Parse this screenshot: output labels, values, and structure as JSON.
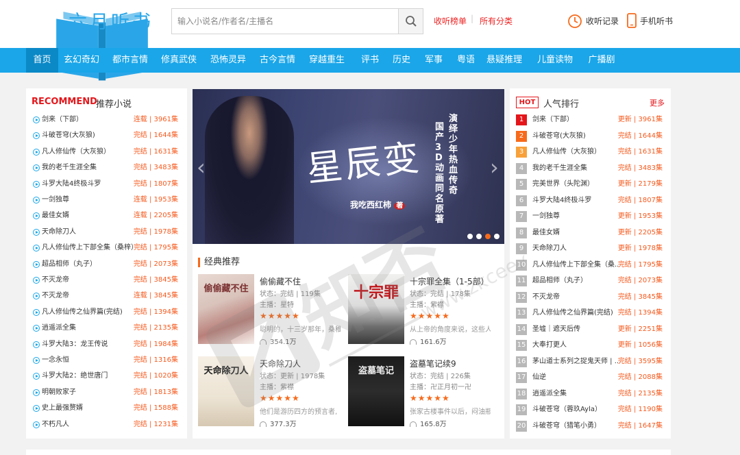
{
  "header": {
    "logo_text": "六月听书",
    "logo_sub": "6yueting",
    "search_placeholder": "输入小说名/作者名/主播名",
    "links": [
      "收听榜单",
      "所有分类"
    ],
    "history_label": "收听记录",
    "mobile_label": "手机听书"
  },
  "nav": [
    "首页",
    "玄幻奇幻",
    "都市言情",
    "修真武侠",
    "恐怖灵异",
    "古今言情",
    "穿越重生",
    "评书",
    "历史",
    "军事",
    "粤语",
    "悬疑推理",
    "儿童读物",
    "广播剧"
  ],
  "recommend": {
    "title_en": "RECOMMEND",
    "title_cn": "推荐小说",
    "items": [
      {
        "name": "剑来（下部）",
        "status": "连载 | 3961集"
      },
      {
        "name": "斗破苍穹(大灰狼)",
        "status": "完结 | 1644集"
      },
      {
        "name": "凡人修仙传（大灰狼）",
        "status": "完结 | 1631集"
      },
      {
        "name": "我的老千生涯全集",
        "status": "完结 | 3483集"
      },
      {
        "name": "斗罗大陆4终极斗罗",
        "status": "完结 | 1807集"
      },
      {
        "name": "一剑独尊",
        "status": "连载 | 1953集"
      },
      {
        "name": "最佳女婿",
        "status": "连载 | 2205集"
      },
      {
        "name": "天命除刀人",
        "status": "完结 | 1978集"
      },
      {
        "name": "凡人修仙传上下部全集（桑梓）",
        "status": "完结 | 1795集"
      },
      {
        "name": "超品相师（丸子）",
        "status": "完结 | 2073集"
      },
      {
        "name": "不灭龙帝",
        "status": "完结 | 3845集"
      },
      {
        "name": "不灭龙帝",
        "status": "连载 | 3845集"
      },
      {
        "name": "凡人修仙传之仙界篇(完结)",
        "status": "完结 | 1394集"
      },
      {
        "name": "逍遥派全集",
        "status": "完结 | 2135集"
      },
      {
        "name": "斗罗大陆3：龙王传说",
        "status": "完结 | 1984集"
      },
      {
        "name": "一念永恒",
        "status": "完结 | 1316集"
      },
      {
        "name": "斗罗大陆2：绝世唐门",
        "status": "完结 | 1020集"
      },
      {
        "name": "明朝败家子",
        "status": "完结 | 1813集"
      },
      {
        "name": "史上最强赘婿",
        "status": "完结 | 1588集"
      },
      {
        "name": "不朽凡人",
        "status": "完结 | 1231集"
      }
    ]
  },
  "banner": {
    "title": "星辰变",
    "vertical_lines": [
      "演绎少年热血传奇",
      "国产3D动画同名原著"
    ],
    "author": "我吃西红柿",
    "author_badge": "著",
    "dots": 4,
    "active_dot": 3,
    "prev": "‹",
    "next": "›"
  },
  "classic": {
    "title": "经典推荐",
    "books": [
      {
        "title": "偷偷藏不住",
        "status": "状态：完结 | 119集",
        "anchor": "主播：星特",
        "stars": "★★★★★",
        "desc": "聪明的，十三岁那年，桑稚",
        "plays": "354.1万",
        "cover_text": "偷偷藏不住"
      },
      {
        "title": "十宗罪全集（1-5部）",
        "status": "状态：完结 | 178集",
        "anchor": "主播：紫襟",
        "stars": "★★★★★",
        "desc": "从上帝的角度来说，这些人",
        "plays": "161.6万",
        "cover_text": "十宗罪"
      },
      {
        "title": "天命除刀人",
        "status": "状态：更新 | 1978集",
        "anchor": "主播：紫襟",
        "stars": "★★★★★",
        "desc": "他们是游历四方的预言者,",
        "plays": "377.3万",
        "cover_text": "天命除刀人"
      },
      {
        "title": "盗墓笔记续9",
        "status": "状态：完结 | 226集",
        "anchor": "主播：卍正月初一卍",
        "stars": "★★★★★",
        "desc": "张家古楼事件以后，闷油瓶",
        "plays": "165.8万",
        "cover_text": "盗墓笔记"
      }
    ]
  },
  "ranking": {
    "badge": "HOT",
    "title": "人气排行",
    "more": "更多",
    "items": [
      {
        "rank": "1",
        "name": "剑来（下部）",
        "status": "更新 | 3961集"
      },
      {
        "rank": "2",
        "name": "斗破苍穹(大灰狼)",
        "status": "完结 | 1644集"
      },
      {
        "rank": "3",
        "name": "凡人修仙传（大灰狼）",
        "status": "完结 | 1631集"
      },
      {
        "rank": "4",
        "name": "我的老千生涯全集",
        "status": "完结 | 3483集"
      },
      {
        "rank": "5",
        "name": "完美世界（头陀渊）",
        "status": "更新 | 2179集"
      },
      {
        "rank": "6",
        "name": "斗罗大陆4终极斗罗",
        "status": "完结 | 1807集"
      },
      {
        "rank": "7",
        "name": "一剑独尊",
        "status": "更新 | 1953集"
      },
      {
        "rank": "8",
        "name": "最佳女婿",
        "status": "更新 | 2205集"
      },
      {
        "rank": "9",
        "name": "天命除刀人",
        "status": "更新 | 1978集"
      },
      {
        "rank": "10",
        "name": "凡人修仙传上下部全集（桑...",
        "status": "完结 | 1795集"
      },
      {
        "rank": "11",
        "name": "超品相师（丸子）",
        "status": "完结 | 2073集"
      },
      {
        "rank": "12",
        "name": "不灭龙帝",
        "status": "完结 | 3845集"
      },
      {
        "rank": "13",
        "name": "凡人修仙传之仙界篇(完结)",
        "status": "完结 | 1394集"
      },
      {
        "rank": "14",
        "name": "圣墟｜遮天后传",
        "status": "更新 | 2251集"
      },
      {
        "rank": "15",
        "name": "大奉打更人",
        "status": "更新 | 1056集"
      },
      {
        "rank": "16",
        "name": "茅山道士系列之捉鬼天师 | ...",
        "status": "完结 | 3595集"
      },
      {
        "rank": "17",
        "name": "仙逆",
        "status": "完结 | 2088集"
      },
      {
        "rank": "18",
        "name": "逍遥派全集",
        "status": "完结 | 2135集"
      },
      {
        "rank": "19",
        "name": "斗破苍穹（蓉玖Ayla）",
        "status": "完结 | 1190集"
      },
      {
        "rank": "20",
        "name": "斗破苍穹（猎笔小勇）",
        "status": "完结 | 1647集"
      }
    ]
  },
  "watermark": "知否网 www.zkcee.com",
  "colors": {
    "brand_blue": "#1aa6e9",
    "red": "#e4161b",
    "orange": "#f76a1b"
  }
}
